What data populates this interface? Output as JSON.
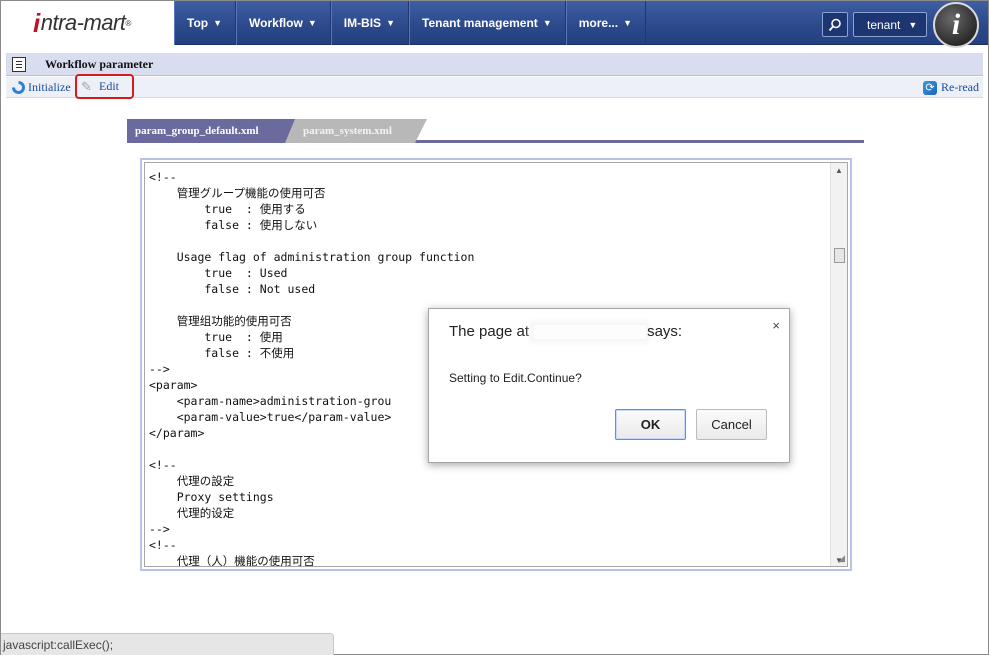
{
  "brand": {
    "logo_i": "i",
    "logo_text": "ntra-mart",
    "logo_mark": "®"
  },
  "nav": {
    "items": [
      {
        "label": "Top"
      },
      {
        "label": "Workflow"
      },
      {
        "label": "IM-BIS"
      },
      {
        "label": "Tenant management"
      },
      {
        "label": "more..."
      }
    ],
    "caret": "▼",
    "tenant_label": "tenant",
    "avatar_letter": "i"
  },
  "page": {
    "title": "Workflow parameter"
  },
  "toolbar": {
    "initialize_label": "Initialize",
    "edit_label": "Edit",
    "reread_label": "Re-read"
  },
  "tabs": [
    {
      "label": "param_group_default.xml",
      "active": true
    },
    {
      "label": "param_system.xml",
      "active": false
    }
  ],
  "editor": {
    "content": "<!--\n    管理グループ機能の使用可否\n        true  : 使用する\n        false : 使用しない\n\n    Usage flag of administration group function\n        true  : Used\n        false : Not used\n\n    管理组功能的使用可否\n        true  : 使用\n        false : 不使用\n-->\n<param>\n    <param-name>administration-grou\n    <param-value>true</param-value>\n</param>\n\n<!--\n    代理の設定\n    Proxy settings\n    代理的设定\n-->\n<!--\n    代理（人）機能の使用可否"
  },
  "dialog": {
    "title_prefix": "The page at",
    "title_suffix": "says:",
    "message": "Setting to Edit.Continue?",
    "ok_label": "OK",
    "cancel_label": "Cancel",
    "close_glyph": "×"
  },
  "status_bar": {
    "text": "javascript:callExec();"
  }
}
